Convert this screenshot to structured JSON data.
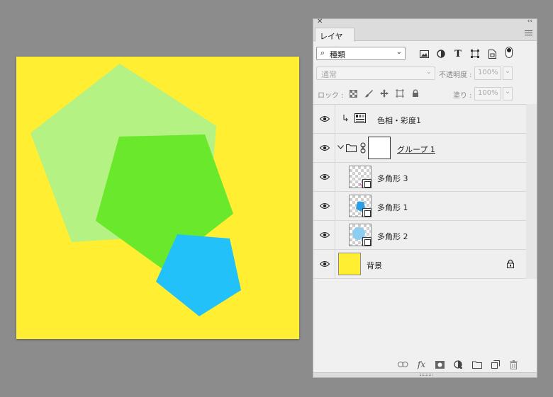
{
  "canvas": {
    "background_color": "#FFEE32",
    "shapes": [
      {
        "name": "pale-green-pentagon",
        "color": "#B4F284"
      },
      {
        "name": "green-pentagon",
        "color": "#6AE82C"
      },
      {
        "name": "blue-pentagon",
        "color": "#22C1FA"
      }
    ]
  },
  "panel": {
    "close_glyph": "✕",
    "collapse_glyph": "‹‹",
    "tab_label": "レイヤー",
    "filter": {
      "search_glyph": "⌕",
      "kind_value": "種類",
      "chevron": "⌄",
      "icons": [
        "image-filter-icon",
        "adjustment-filter-icon",
        "type-filter-icon",
        "shape-filter-icon",
        "smart-object-filter-icon"
      ],
      "type_glyph": "T"
    },
    "blend_mode": "通常",
    "opacity_label": "不透明度 :",
    "opacity_value": "100%",
    "lock_label": "ロック :",
    "fill_label": "塗り :",
    "fill_value": "100%",
    "dropdown_arrow": "⌄",
    "layers": [
      {
        "name": "色相・彩度1",
        "kind": "adjustment"
      },
      {
        "name": "グループ 1",
        "kind": "group"
      },
      {
        "name": "多角形 3",
        "kind": "shape"
      },
      {
        "name": "多角形 1",
        "kind": "shape"
      },
      {
        "name": "多角形 2",
        "kind": "shape"
      },
      {
        "name": "背景",
        "kind": "background",
        "thumb_color": "#FFEE32"
      }
    ],
    "bottom_icons": [
      "link-layers-icon",
      "fx-icon",
      "add-mask-icon",
      "new-fill-adjustment-icon",
      "new-group-icon",
      "new-layer-icon",
      "delete-layer-icon"
    ],
    "fx_label": "fx"
  }
}
